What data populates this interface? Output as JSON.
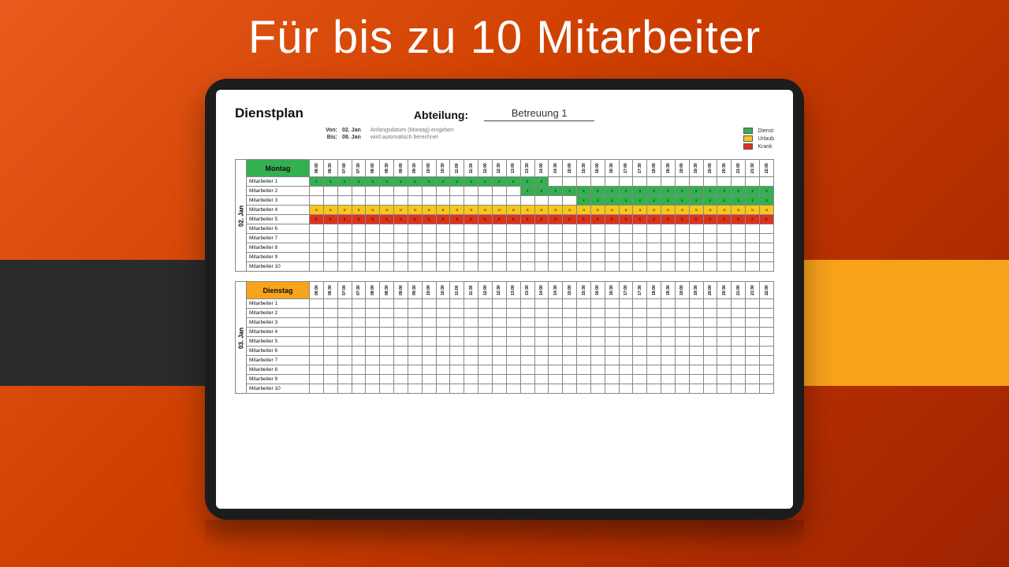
{
  "title": "Für bis zu 10 Mitarbeiter",
  "sheet": {
    "title": "Dienstplan",
    "dept_label": "Abteilung:",
    "dept_value": "Betreuung 1",
    "from_label": "Von:",
    "from_value": "02. Jan",
    "from_note": "Anfangsdatum (Montag) eingeben",
    "to_label": "Bis:",
    "to_value": "08. Jan",
    "to_note": "wird automatisch berechnet"
  },
  "legend": {
    "dienst": "Dienst",
    "urlaub": "Urlaub",
    "krank": "Krank"
  },
  "colors": {
    "green": "#33b050",
    "yellow": "#f7c81b",
    "red": "#e03020"
  },
  "times": [
    "06:00",
    "06:30",
    "07:00",
    "07:30",
    "08:00",
    "08:30",
    "09:00",
    "09:30",
    "10:00",
    "10:30",
    "11:00",
    "11:30",
    "12:00",
    "12:30",
    "13:00",
    "13:30",
    "14:00",
    "14:30",
    "15:00",
    "15:30",
    "16:00",
    "16:30",
    "17:00",
    "17:30",
    "18:00",
    "18:30",
    "19:00",
    "19:30",
    "20:00",
    "20:30",
    "21:00",
    "21:30",
    "22:00"
  ],
  "employees": [
    "Mitarbeiter 1",
    "Mitarbeiter 2",
    "Mitarbeiter 3",
    "Mitarbeiter 4",
    "Mitarbeiter 5",
    "Mitarbeiter 6",
    "Mitarbeiter 7",
    "Mitarbeiter 8",
    "Mitarbeiter 9",
    "Mitarbeiter 10"
  ],
  "chart_data": [
    {
      "type": "table",
      "day_label": "Montag",
      "date_label": "02. Jan",
      "header_color": "green",
      "rows": [
        {
          "name": "Mitarbeiter 1",
          "cells": [
            "x",
            "x",
            "x",
            "x",
            "x",
            "x",
            "x",
            "x",
            "x",
            "x",
            "x",
            "x",
            "x",
            "x",
            "x",
            "x",
            "x",
            "",
            "",
            "",
            "",
            "",
            "",
            "",
            "",
            "",
            "",
            "",
            "",
            "",
            "",
            "",
            ""
          ],
          "colors": [
            "green",
            "green",
            "green",
            "green",
            "green",
            "green",
            "green",
            "green",
            "green",
            "green",
            "green",
            "green",
            "green",
            "green",
            "green",
            "green",
            "green",
            "",
            "",
            "",
            "",
            "",
            "",
            "",
            "",
            "",
            "",
            "",
            "",
            "",
            "",
            "",
            ""
          ]
        },
        {
          "name": "Mitarbeiter 2",
          "cells": [
            "",
            "",
            "",
            "",
            "",
            "",
            "",
            "",
            "",
            "",
            "",
            "",
            "",
            "",
            "",
            "x",
            "x",
            "x",
            "x",
            "x",
            "x",
            "x",
            "x",
            "x",
            "x",
            "x",
            "x",
            "x",
            "x",
            "x",
            "x",
            "x",
            "x"
          ],
          "colors": [
            "",
            "",
            "",
            "",
            "",
            "",
            "",
            "",
            "",
            "",
            "",
            "",
            "",
            "",
            "",
            "green",
            "green",
            "green",
            "green",
            "green",
            "green",
            "green",
            "green",
            "green",
            "green",
            "green",
            "green",
            "green",
            "green",
            "green",
            "green",
            "green",
            "green"
          ]
        },
        {
          "name": "Mitarbeiter 3",
          "cells": [
            "",
            "",
            "",
            "",
            "",
            "",
            "",
            "",
            "",
            "",
            "",
            "",
            "",
            "",
            "",
            "",
            "",
            "",
            "",
            "x",
            "x",
            "x",
            "x",
            "x",
            "x",
            "x",
            "x",
            "x",
            "x",
            "x",
            "x",
            "x",
            "x"
          ],
          "colors": [
            "",
            "",
            "",
            "",
            "",
            "",
            "",
            "",
            "",
            "",
            "",
            "",
            "",
            "",
            "",
            "",
            "",
            "",
            "",
            "green",
            "green",
            "green",
            "green",
            "green",
            "green",
            "green",
            "green",
            "green",
            "green",
            "green",
            "green",
            "green",
            "green"
          ]
        },
        {
          "name": "Mitarbeiter 4",
          "cells": [
            "u",
            "u",
            "u",
            "u",
            "u",
            "u",
            "u",
            "u",
            "u",
            "u",
            "u",
            "u",
            "u",
            "u",
            "u",
            "u",
            "u",
            "u",
            "u",
            "u",
            "u",
            "u",
            "u",
            "u",
            "u",
            "u",
            "u",
            "u",
            "u",
            "u",
            "u",
            "u",
            "u"
          ],
          "colors": [
            "yellow",
            "yellow",
            "yellow",
            "yellow",
            "yellow",
            "yellow",
            "yellow",
            "yellow",
            "yellow",
            "yellow",
            "yellow",
            "yellow",
            "yellow",
            "yellow",
            "yellow",
            "yellow",
            "yellow",
            "yellow",
            "yellow",
            "yellow",
            "yellow",
            "yellow",
            "yellow",
            "yellow",
            "yellow",
            "yellow",
            "yellow",
            "yellow",
            "yellow",
            "yellow",
            "yellow",
            "yellow",
            "yellow"
          ]
        },
        {
          "name": "Mitarbeiter 5",
          "cells": [
            "k",
            "k",
            "k",
            "k",
            "k",
            "k",
            "k",
            "k",
            "k",
            "k",
            "k",
            "k",
            "k",
            "k",
            "k",
            "k",
            "k",
            "k",
            "k",
            "k",
            "k",
            "k",
            "k",
            "k",
            "k",
            "k",
            "k",
            "k",
            "k",
            "k",
            "k",
            "k",
            "k"
          ],
          "colors": [
            "red",
            "red",
            "red",
            "red",
            "red",
            "red",
            "red",
            "red",
            "red",
            "red",
            "red",
            "red",
            "red",
            "red",
            "red",
            "red",
            "red",
            "red",
            "red",
            "red",
            "red",
            "red",
            "red",
            "red",
            "red",
            "red",
            "red",
            "red",
            "red",
            "red",
            "red",
            "red",
            "red"
          ]
        },
        {
          "name": "Mitarbeiter 6",
          "cells": [
            "",
            "",
            "",
            "",
            "",
            "",
            "",
            "",
            "",
            "",
            "",
            "",
            "",
            "",
            "",
            "",
            "",
            "",
            "",
            "",
            "",
            "",
            "",
            "",
            "",
            "",
            "",
            "",
            "",
            "",
            "",
            "",
            ""
          ],
          "colors": []
        },
        {
          "name": "Mitarbeiter 7",
          "cells": [
            "",
            "",
            "",
            "",
            "",
            "",
            "",
            "",
            "",
            "",
            "",
            "",
            "",
            "",
            "",
            "",
            "",
            "",
            "",
            "",
            "",
            "",
            "",
            "",
            "",
            "",
            "",
            "",
            "",
            "",
            "",
            "",
            ""
          ],
          "colors": []
        },
        {
          "name": "Mitarbeiter 8",
          "cells": [
            "",
            "",
            "",
            "",
            "",
            "",
            "",
            "",
            "",
            "",
            "",
            "",
            "",
            "",
            "",
            "",
            "",
            "",
            "",
            "",
            "",
            "",
            "",
            "",
            "",
            "",
            "",
            "",
            "",
            "",
            "",
            "",
            ""
          ],
          "colors": []
        },
        {
          "name": "Mitarbeiter 9",
          "cells": [
            "",
            "",
            "",
            "",
            "",
            "",
            "",
            "",
            "",
            "",
            "",
            "",
            "",
            "",
            "",
            "",
            "",
            "",
            "",
            "",
            "",
            "",
            "",
            "",
            "",
            "",
            "",
            "",
            "",
            "",
            "",
            "",
            ""
          ],
          "colors": []
        },
        {
          "name": "Mitarbeiter 10",
          "cells": [
            "",
            "",
            "",
            "",
            "",
            "",
            "",
            "",
            "",
            "",
            "",
            "",
            "",
            "",
            "",
            "",
            "",
            "",
            "",
            "",
            "",
            "",
            "",
            "",
            "",
            "",
            "",
            "",
            "",
            "",
            "",
            "",
            ""
          ],
          "colors": []
        }
      ]
    },
    {
      "type": "table",
      "day_label": "Dienstag",
      "date_label": "03. Jan",
      "header_color": "yellow",
      "rows": [
        {
          "name": "Mitarbeiter 1",
          "cells": [],
          "colors": []
        },
        {
          "name": "Mitarbeiter 2",
          "cells": [],
          "colors": []
        },
        {
          "name": "Mitarbeiter 3",
          "cells": [],
          "colors": []
        },
        {
          "name": "Mitarbeiter 4",
          "cells": [],
          "colors": []
        },
        {
          "name": "Mitarbeiter 5",
          "cells": [],
          "colors": []
        },
        {
          "name": "Mitarbeiter 6",
          "cells": [],
          "colors": []
        },
        {
          "name": "Mitarbeiter 7",
          "cells": [],
          "colors": []
        },
        {
          "name": "Mitarbeiter 8",
          "cells": [],
          "colors": []
        },
        {
          "name": "Mitarbeiter 9",
          "cells": [],
          "colors": []
        },
        {
          "name": "Mitarbeiter 10",
          "cells": [],
          "colors": []
        }
      ]
    }
  ]
}
